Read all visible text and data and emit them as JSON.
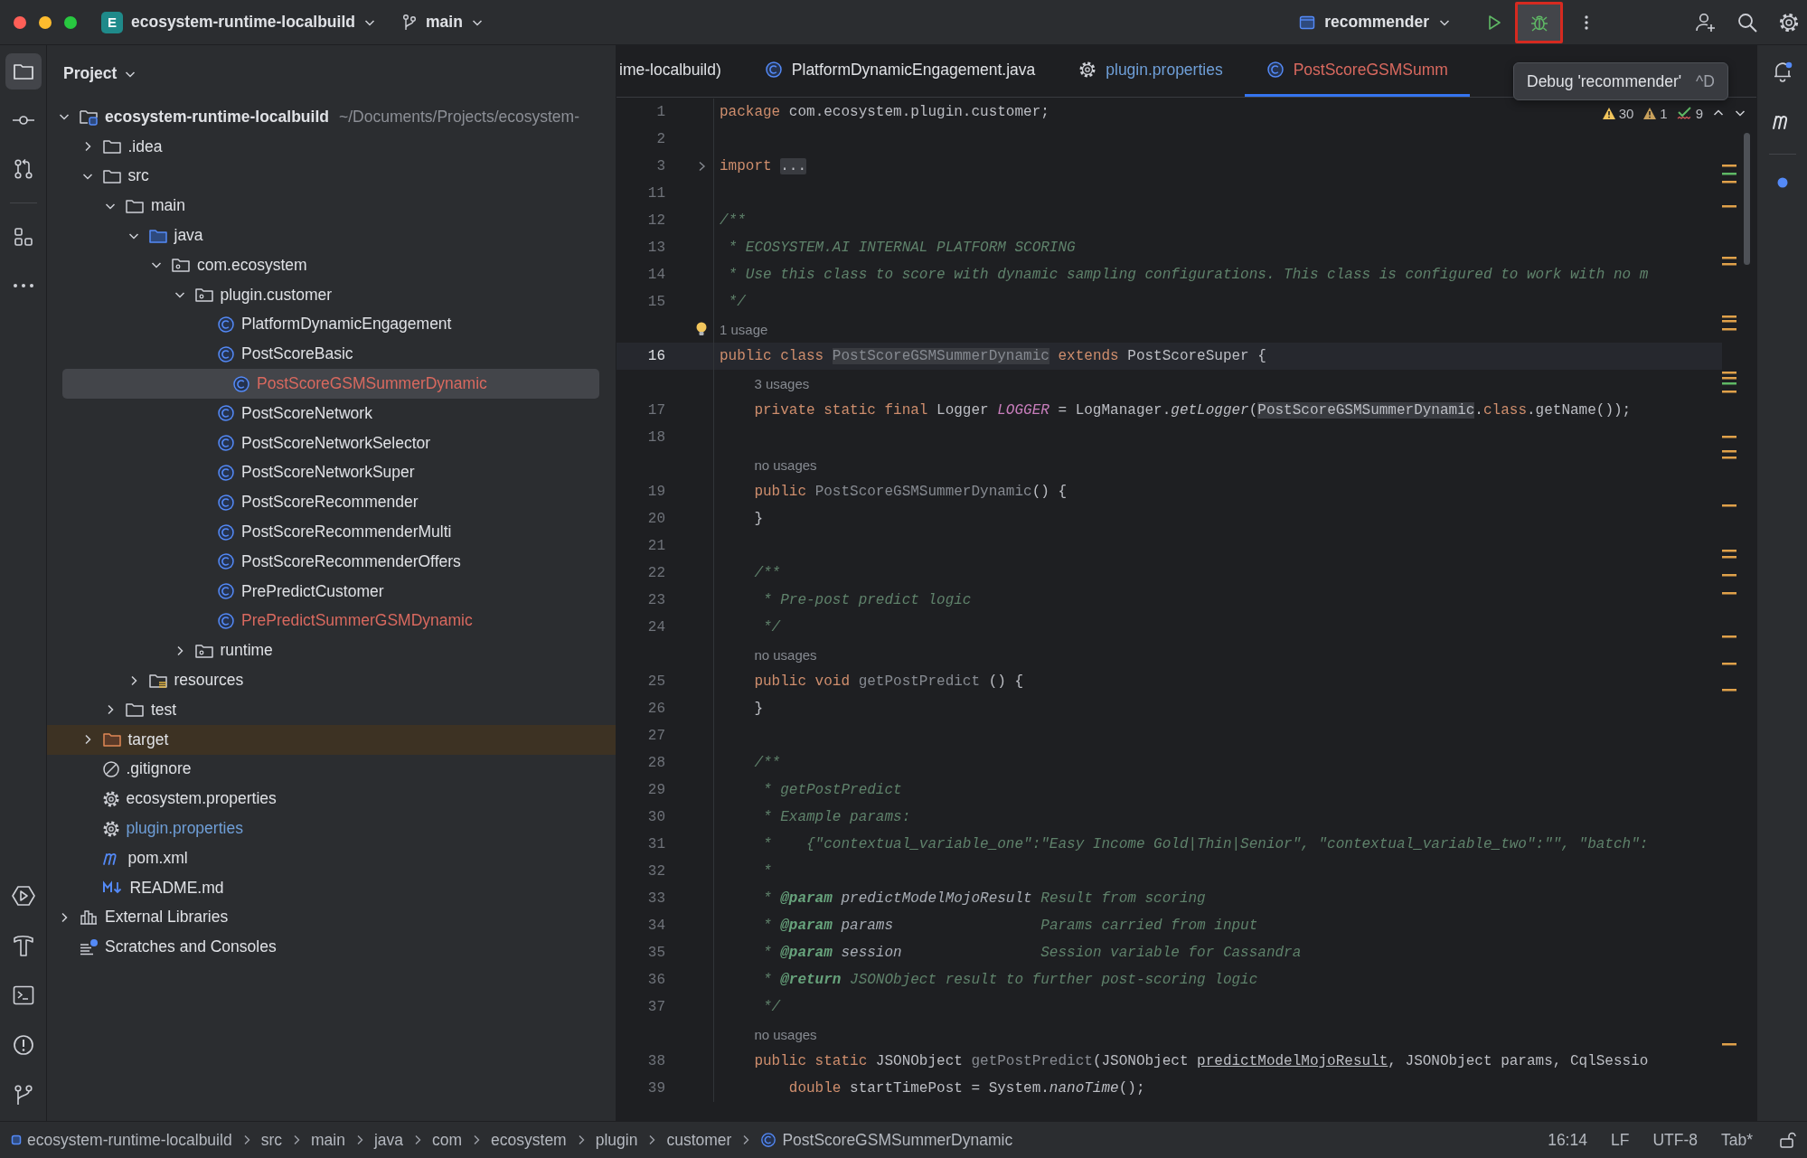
{
  "top_bar": {
    "project": {
      "badge": "E",
      "name": "ecosystem-runtime-localbuild"
    },
    "branch": "main",
    "run_config": "recommender"
  },
  "tool_window": {
    "title": "Project"
  },
  "project_tree": [
    {
      "label": "ecosystem-runtime-localbuild",
      "path": "~/Documents/Projects/ecosystem-",
      "kind": "module",
      "expanded": true,
      "selected": false,
      "color": "#dfe1e5",
      "children": [
        {
          "label": ".idea",
          "kind": "folder",
          "expanded": false,
          "selected": false,
          "color": "#dfe1e5"
        },
        {
          "label": "src",
          "kind": "folder",
          "expanded": true,
          "selected": false,
          "color": "#dfe1e5",
          "children": [
            {
              "label": "main",
              "kind": "folder",
              "expanded": true,
              "selected": false,
              "color": "#dfe1e5",
              "children": [
                {
                  "label": "java",
                  "kind": "source-folder",
                  "expanded": true,
                  "selected": false,
                  "color": "#dfe1e5",
                  "children": [
                    {
                      "label": "com.ecosystem",
                      "kind": "package",
                      "expanded": true,
                      "selected": false,
                      "color": "#dfe1e5",
                      "children": [
                        {
                          "label": "plugin.customer",
                          "kind": "package",
                          "expanded": true,
                          "selected": false,
                          "color": "#dfe1e5",
                          "children": [
                            {
                              "label": "PlatformDynamicEngagement",
                              "kind": "class",
                              "selected": false,
                              "color": "#dfe1e5"
                            },
                            {
                              "label": "PostScoreBasic",
                              "kind": "class",
                              "selected": false,
                              "color": "#dfe1e5"
                            },
                            {
                              "label": "PostScoreGSMSummerDynamic",
                              "kind": "class",
                              "selected": true,
                              "color": "#d9695f"
                            },
                            {
                              "label": "PostScoreNetwork",
                              "kind": "class",
                              "selected": false,
                              "color": "#dfe1e5"
                            },
                            {
                              "label": "PostScoreNetworkSelector",
                              "kind": "class",
                              "selected": false,
                              "color": "#dfe1e5"
                            },
                            {
                              "label": "PostScoreNetworkSuper",
                              "kind": "class",
                              "selected": false,
                              "color": "#dfe1e5"
                            },
                            {
                              "label": "PostScoreRecommender",
                              "kind": "class",
                              "selected": false,
                              "color": "#dfe1e5"
                            },
                            {
                              "label": "PostScoreRecommenderMulti",
                              "kind": "class",
                              "selected": false,
                              "color": "#dfe1e5"
                            },
                            {
                              "label": "PostScoreRecommenderOffers",
                              "kind": "class",
                              "selected": false,
                              "color": "#dfe1e5"
                            },
                            {
                              "label": "PrePredictCustomer",
                              "kind": "class",
                              "selected": false,
                              "color": "#dfe1e5"
                            },
                            {
                              "label": "PrePredictSummerGSMDynamic",
                              "kind": "class",
                              "selected": false,
                              "color": "#d9695f"
                            }
                          ]
                        },
                        {
                          "label": "runtime",
                          "kind": "package",
                          "expanded": false,
                          "selected": false,
                          "color": "#dfe1e5"
                        }
                      ]
                    }
                  ]
                },
                {
                  "label": "resources",
                  "kind": "resources-folder",
                  "expanded": false,
                  "selected": false,
                  "color": "#dfe1e5"
                }
              ]
            },
            {
              "label": "test",
              "kind": "folder",
              "expanded": false,
              "selected": false,
              "color": "#dfe1e5"
            }
          ]
        },
        {
          "label": "target",
          "kind": "excluded-folder",
          "expanded": false,
          "selected": false,
          "color": "#dfe1e5"
        },
        {
          "label": ".gitignore",
          "kind": "ignore",
          "selected": false,
          "color": "#dfe1e5"
        },
        {
          "label": "ecosystem.properties",
          "kind": "settings",
          "selected": false,
          "color": "#dfe1e5"
        },
        {
          "label": "plugin.properties",
          "kind": "settings",
          "selected": false,
          "color": "#6f9fd8"
        },
        {
          "label": "pom.xml",
          "kind": "maven",
          "selected": false,
          "color": "#dfe1e5"
        },
        {
          "label": "README.md",
          "kind": "markdown",
          "selected": false,
          "color": "#dfe1e5"
        }
      ]
    },
    {
      "label": "External Libraries",
      "kind": "library",
      "expanded": false,
      "selected": false,
      "color": "#dfe1e5"
    },
    {
      "label": "Scratches and Consoles",
      "kind": "scratches",
      "selected": false,
      "color": "#dfe1e5"
    }
  ],
  "editor_tabs": [
    {
      "label": "ime-localbuild)",
      "selected": false,
      "color": "#dfe1e5"
    },
    {
      "label": "PlatformDynamicEngagement.java",
      "kind": "class",
      "selected": false,
      "color": "#dfe1e5"
    },
    {
      "label": "plugin.properties",
      "kind": "settings",
      "selected": false,
      "color": "#6f9fd8"
    },
    {
      "label": "PostScoreGSMSumm",
      "kind": "class",
      "selected": true,
      "color": "#d9695f"
    }
  ],
  "tooltip": {
    "text": "Debug 'recommender'",
    "shortcut": "^D"
  },
  "inspections": [
    {
      "kind": "warning",
      "count": "30"
    },
    {
      "kind": "weak-warning",
      "count": "1"
    },
    {
      "kind": "typo",
      "count": "9"
    }
  ],
  "code": [
    {
      "kind": "code",
      "number": "1",
      "current": false,
      "tokens": [
        {
          "kind": "keyword",
          "text": "package"
        },
        {
          "kind": "plain",
          "text": " com.ecosystem.plugin.customer;"
        }
      ]
    },
    {
      "kind": "code",
      "number": "2",
      "current": false
    },
    {
      "kind": "code",
      "number": "3",
      "current": false,
      "tokens": [
        {
          "kind": "keyword",
          "text": "import "
        },
        {
          "kind": "folded",
          "text": "..."
        }
      ]
    },
    {
      "kind": "code",
      "number": "11",
      "current": false
    },
    {
      "kind": "code",
      "number": "12",
      "current": false,
      "tokens": [
        {
          "kind": "comment",
          "text": "/**"
        }
      ]
    },
    {
      "kind": "code",
      "number": "13",
      "current": false,
      "tokens": [
        {
          "kind": "comment",
          "text": " * ECOSYSTEM.AI INTERNAL PLATFORM SCORING"
        }
      ]
    },
    {
      "kind": "code",
      "number": "14",
      "current": false,
      "tokens": [
        {
          "kind": "comment",
          "text": " * Use this class to score with dynamic sampling configurations. This class is configured to work with no m"
        }
      ]
    },
    {
      "kind": "code",
      "number": "15",
      "current": false,
      "tokens": [
        {
          "kind": "comment",
          "text": " */"
        }
      ]
    },
    {
      "kind": "hint",
      "text": "1 usage",
      "intention": true
    },
    {
      "kind": "code",
      "number": "16",
      "current": true,
      "tokens": [
        {
          "kind": "keyword",
          "text": "public class "
        },
        {
          "kind": "unusedmark",
          "text": "PostScoreGSMSummerDynamic"
        },
        {
          "kind": "keyword",
          "text": " extends"
        },
        {
          "kind": "plain",
          "text": " PostScoreSuper {"
        }
      ]
    },
    {
      "kind": "hint",
      "text": "3 usages",
      "intention": false
    },
    {
      "kind": "code",
      "number": "17",
      "current": false,
      "tokens": [
        {
          "kind": "keyword",
          "text": "    private static final"
        },
        {
          "kind": "plain",
          "text": " Logger "
        },
        {
          "kind": "field",
          "text": "LOGGER"
        },
        {
          "kind": "plain",
          "text": " = LogManager."
        },
        {
          "kind": "call",
          "text": "getLogger"
        },
        {
          "kind": "plain",
          "text": "("
        },
        {
          "kind": "mark",
          "text": "PostScoreGSMSummerDynamic"
        },
        {
          "kind": "plain",
          "text": "."
        },
        {
          "kind": "keyword",
          "text": "class"
        },
        {
          "kind": "plain",
          "text": ".getName());"
        }
      ]
    },
    {
      "kind": "code",
      "number": "18",
      "current": false
    },
    {
      "kind": "hint",
      "text": "no usages",
      "intention": false
    },
    {
      "kind": "code",
      "number": "19",
      "current": false,
      "tokens": [
        {
          "kind": "keyword",
          "text": "    public "
        },
        {
          "kind": "unused",
          "text": "PostScoreGSMSummerDynamic"
        },
        {
          "kind": "plain",
          "text": "() {"
        }
      ]
    },
    {
      "kind": "code",
      "number": "20",
      "current": false,
      "tokens": [
        {
          "kind": "plain",
          "text": "    }"
        }
      ]
    },
    {
      "kind": "code",
      "number": "21",
      "current": false
    },
    {
      "kind": "code",
      "number": "22",
      "current": false,
      "tokens": [
        {
          "kind": "comment",
          "text": "    /**"
        }
      ]
    },
    {
      "kind": "code",
      "number": "23",
      "current": false,
      "tokens": [
        {
          "kind": "comment",
          "text": "     * Pre-post predict logic"
        }
      ]
    },
    {
      "kind": "code",
      "number": "24",
      "current": false,
      "tokens": [
        {
          "kind": "comment",
          "text": "     */"
        }
      ]
    },
    {
      "kind": "hint",
      "text": "no usages",
      "intention": false
    },
    {
      "kind": "code",
      "number": "25",
      "current": false,
      "tokens": [
        {
          "kind": "keyword",
          "text": "    public void "
        },
        {
          "kind": "unused",
          "text": "getPostPredict"
        },
        {
          "kind": "plain",
          "text": " () {"
        }
      ]
    },
    {
      "kind": "code",
      "number": "26",
      "current": false,
      "tokens": [
        {
          "kind": "plain",
          "text": "    }"
        }
      ]
    },
    {
      "kind": "code",
      "number": "27",
      "current": false
    },
    {
      "kind": "code",
      "number": "28",
      "current": false,
      "tokens": [
        {
          "kind": "comment",
          "text": "    /**"
        }
      ]
    },
    {
      "kind": "code",
      "number": "29",
      "current": false,
      "tokens": [
        {
          "kind": "comment",
          "text": "     * getPostPredict"
        }
      ]
    },
    {
      "kind": "code",
      "number": "30",
      "current": false,
      "tokens": [
        {
          "kind": "comment",
          "text": "     * Example params:"
        }
      ]
    },
    {
      "kind": "code",
      "number": "31",
      "current": false,
      "tokens": [
        {
          "kind": "comment",
          "text": "     *    {\"contextual_variable_one\":\"Easy Income Gold|Thin|Senior\", \"contextual_variable_two\":\"\", \"batch\":"
        }
      ]
    },
    {
      "kind": "code",
      "number": "32",
      "current": false,
      "tokens": [
        {
          "kind": "comment",
          "text": "     *"
        }
      ]
    },
    {
      "kind": "code",
      "number": "33",
      "current": false,
      "tokens": [
        {
          "kind": "comment",
          "text": "     *"
        },
        {
          "kind": "doctag",
          "text": " @param"
        },
        {
          "kind": "docparam",
          "text": " predictModelMojoResult"
        },
        {
          "kind": "comment",
          "text": " Result from scoring"
        }
      ]
    },
    {
      "kind": "code",
      "number": "34",
      "current": false,
      "tokens": [
        {
          "kind": "comment",
          "text": "     *"
        },
        {
          "kind": "doctag",
          "text": " @param"
        },
        {
          "kind": "docparam",
          "text": " params"
        },
        {
          "kind": "comment",
          "text": "                 Params carried from input"
        }
      ]
    },
    {
      "kind": "code",
      "number": "35",
      "current": false,
      "tokens": [
        {
          "kind": "comment",
          "text": "     *"
        },
        {
          "kind": "doctag",
          "text": " @param"
        },
        {
          "kind": "docparam",
          "text": " session"
        },
        {
          "kind": "comment",
          "text": "                Session variable for Cassandra"
        }
      ]
    },
    {
      "kind": "code",
      "number": "36",
      "current": false,
      "tokens": [
        {
          "kind": "comment",
          "text": "     *"
        },
        {
          "kind": "doctag",
          "text": " @return"
        },
        {
          "kind": "comment",
          "text": " JSONObject result to further post-scoring logic"
        }
      ]
    },
    {
      "kind": "code",
      "number": "37",
      "current": false,
      "tokens": [
        {
          "kind": "comment",
          "text": "     */"
        }
      ]
    },
    {
      "kind": "hint",
      "text": "no usages",
      "intention": false
    },
    {
      "kind": "code",
      "number": "38",
      "current": false,
      "tokens": [
        {
          "kind": "keyword",
          "text": "    public static"
        },
        {
          "kind": "plain",
          "text": " JSONObject "
        },
        {
          "kind": "unused",
          "text": "getPostPredict"
        },
        {
          "kind": "plain",
          "text": "(JSONObject "
        },
        {
          "kind": "underline",
          "text": "predictModelMojoResult"
        },
        {
          "kind": "plain",
          "text": ", JSONObject params, CqlSessio"
        }
      ]
    },
    {
      "kind": "code",
      "number": "39",
      "current": false,
      "tokens": [
        {
          "kind": "keyword",
          "text": "        double"
        },
        {
          "kind": "plain",
          "text": " startTimePost = System."
        },
        {
          "kind": "call",
          "text": "nanoTime"
        },
        {
          "kind": "plain",
          "text": "();"
        }
      ]
    }
  ],
  "status_bar": {
    "breadcrumbs": [
      {
        "label": "ecosystem-runtime-localbuild",
        "kind": "module"
      },
      {
        "label": "src"
      },
      {
        "label": "main"
      },
      {
        "label": "java"
      },
      {
        "label": "com"
      },
      {
        "label": "ecosystem"
      },
      {
        "label": "plugin"
      },
      {
        "label": "customer"
      },
      {
        "label": "PostScoreGSMSummerDynamic",
        "kind": "class"
      }
    ],
    "items": [
      "16:14",
      "LF",
      "UTF-8",
      "Tab*"
    ]
  }
}
